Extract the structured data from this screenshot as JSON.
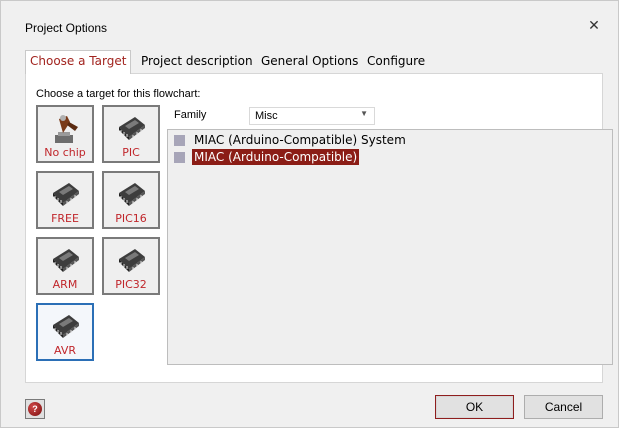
{
  "window": {
    "title": "Project Options",
    "close_glyph": "✕"
  },
  "tabs": [
    {
      "label": "Choose a Target",
      "active": true
    },
    {
      "label": "Project description",
      "active": false
    },
    {
      "label": "General Options",
      "active": false
    },
    {
      "label": "Configure",
      "active": false
    }
  ],
  "target_panel": {
    "heading": "Choose a target for this flowchart:",
    "chips": [
      {
        "label": "No chip",
        "icon": "no-chip-icon"
      },
      {
        "label": "PIC",
        "icon": "chip-icon"
      },
      {
        "label": "FREE",
        "icon": "chip-icon"
      },
      {
        "label": "PIC16",
        "icon": "chip-icon"
      },
      {
        "label": "ARM",
        "icon": "chip-icon"
      },
      {
        "label": "PIC32",
        "icon": "chip-icon"
      },
      {
        "label": "AVR",
        "icon": "chip-icon",
        "selected": true
      }
    ],
    "family_label": "Family",
    "family_value": "Misc",
    "family_arrow": "▼",
    "devices": [
      {
        "label": "MIAC (Arduino-Compatible) System",
        "selected": false
      },
      {
        "label": "MIAC (Arduino-Compatible)",
        "selected": true
      }
    ]
  },
  "footer": {
    "help_glyph": "?",
    "ok_label": "OK",
    "cancel_label": "Cancel"
  },
  "colors": {
    "accent_red": "#a2241f",
    "selection_bg": "#8b1d16",
    "selected_chip_border": "#2b6fb6"
  }
}
